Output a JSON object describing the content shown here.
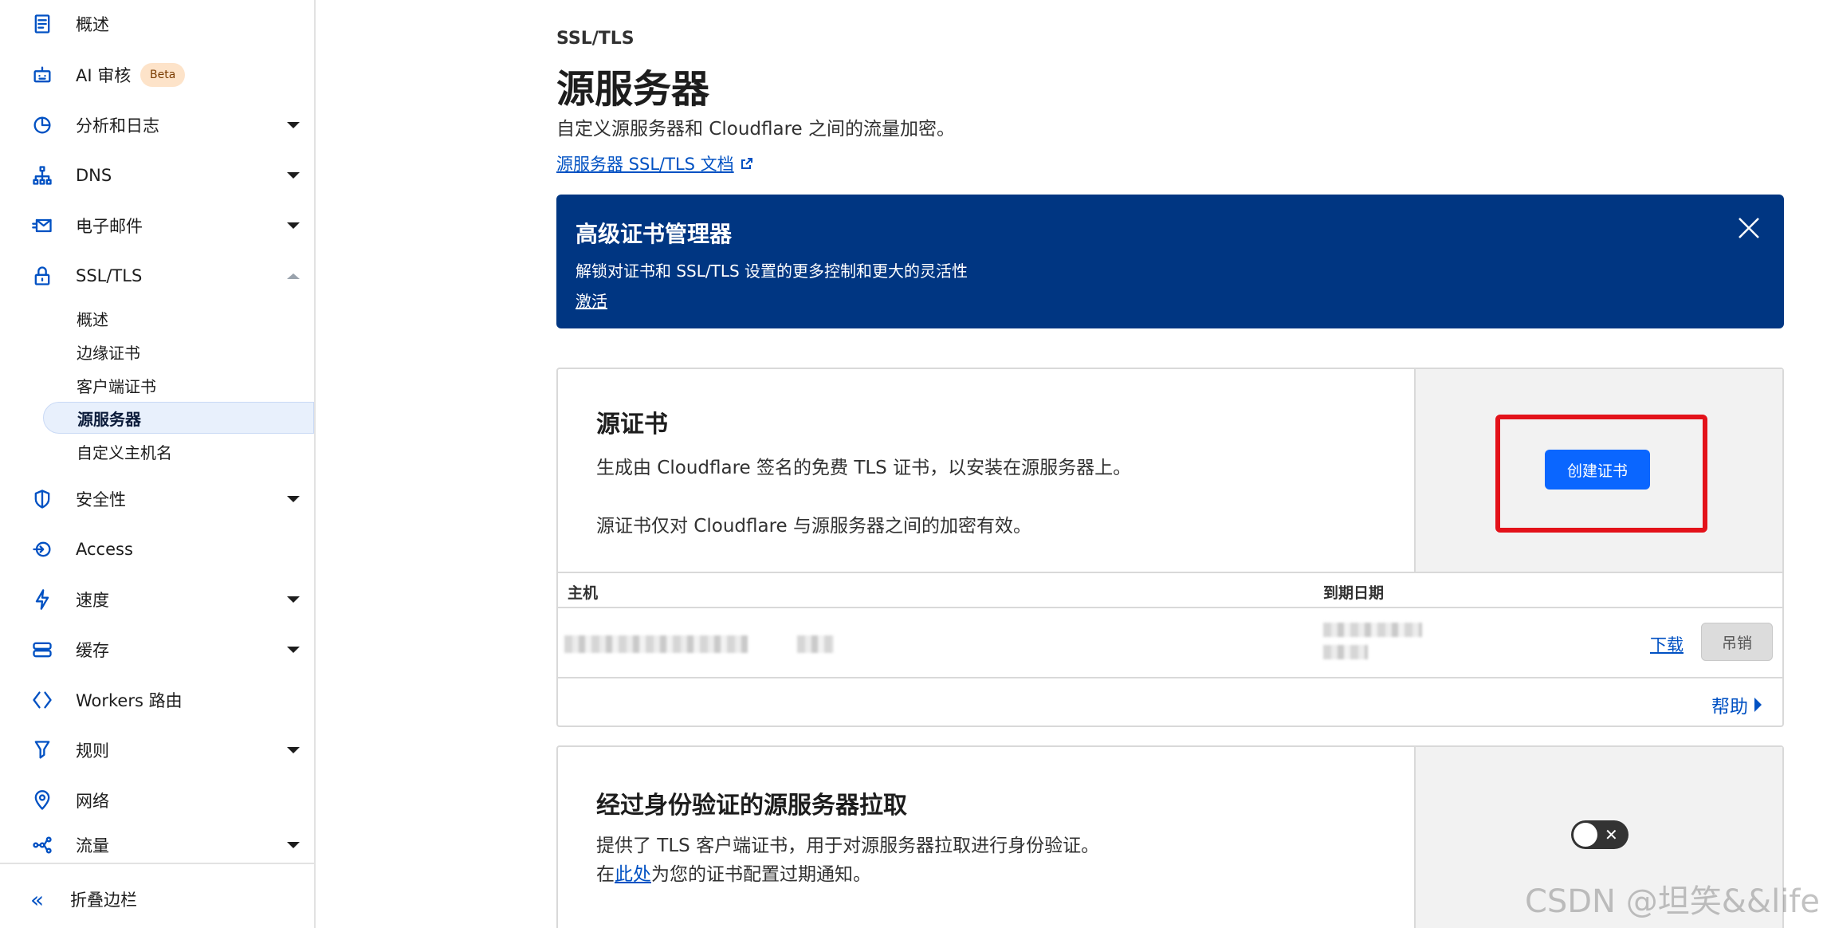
{
  "sidebar": {
    "items": [
      {
        "label": "概述",
        "icon": "document-icon"
      },
      {
        "label": "AI 审核",
        "icon": "robot-icon",
        "badge": "Beta"
      },
      {
        "label": "分析和日志",
        "icon": "pie-chart-icon"
      },
      {
        "label": "DNS",
        "icon": "network-icon"
      },
      {
        "label": "电子邮件",
        "icon": "email-icon"
      },
      {
        "label": "SSL/TLS",
        "icon": "lock-icon"
      },
      {
        "label": "安全性",
        "icon": "shield-icon"
      },
      {
        "label": "Access",
        "icon": "access-icon"
      },
      {
        "label": "速度",
        "icon": "lightning-icon"
      },
      {
        "label": "缓存",
        "icon": "storage-icon"
      },
      {
        "label": "Workers 路由",
        "icon": "workers-icon"
      },
      {
        "label": "规则",
        "icon": "funnel-icon"
      },
      {
        "label": "网络",
        "icon": "location-pin-icon"
      },
      {
        "label": "流量",
        "icon": "traffic-icon"
      }
    ],
    "ssl_subitems": [
      "概述",
      "边缘证书",
      "客户端证书",
      "源服务器",
      "自定义主机名"
    ],
    "active_subitem": "源服务器",
    "collapse_label": "折叠边栏"
  },
  "page": {
    "breadcrumb": "SSL/TLS",
    "title": "源服务器",
    "subtitle": "自定义源服务器和 Cloudflare 之间的流量加密。",
    "doc_link": "源服务器 SSL/TLS 文档"
  },
  "banner": {
    "title": "高级证书管理器",
    "text": "解锁对证书和 SSL/TLS 设置的更多控制和更大的灵活性",
    "link": "激活"
  },
  "origin_cert": {
    "title": "源证书",
    "desc1": "生成由 Cloudflare 签名的免费 TLS 证书，以安装在源服务器上。",
    "desc2": "源证书仅对 Cloudflare 与源服务器之间的加密有效。",
    "create_button": "创建证书",
    "table_headers": {
      "host": "主机",
      "expiry": "到期日期"
    },
    "download_label": "下载",
    "revoke_label": "吊销",
    "help_label": "帮助"
  },
  "auth_pull": {
    "title": "经过身份验证的源服务器拉取",
    "desc1": "提供了 TLS 客户端证书，用于对源服务器拉取进行身份验证。",
    "desc2_prefix": "在",
    "desc2_link": "此处",
    "desc2_suffix": "为您的证书配置过期通知。",
    "toggle_on": false
  },
  "watermark": "CSDN @坦笑&&life",
  "colors": {
    "accent": "#0051c3",
    "banner": "#003682",
    "primary_button": "#0a66ff",
    "highlight": "#e3121a"
  }
}
